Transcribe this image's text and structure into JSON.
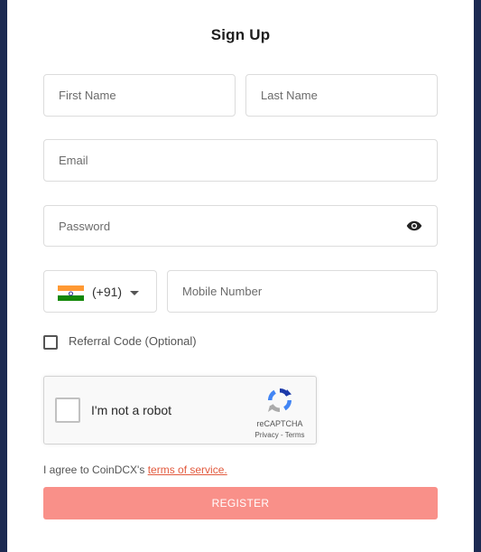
{
  "title": "Sign Up",
  "fields": {
    "first_name_placeholder": "First Name",
    "last_name_placeholder": "Last Name",
    "email_placeholder": "Email",
    "password_placeholder": "Password",
    "mobile_placeholder": "Mobile Number"
  },
  "country": {
    "code": "(+91)",
    "flag_icon": "india-flag-icon",
    "flag_colors": [
      "#ff9933",
      "#ffffff",
      "#138808"
    ]
  },
  "referral": {
    "label": "Referral Code (Optional)",
    "checked": false
  },
  "captcha": {
    "label": "I'm not a robot",
    "brand": "reCAPTCHA",
    "privacy": "Privacy",
    "separator": " - ",
    "terms": "Terms"
  },
  "agreement": {
    "text": "I agree to CoinDCX's ",
    "link": "terms of service."
  },
  "register_label": "REGISTER",
  "colors": {
    "background": "#1c2a52",
    "register_button": "#f99089",
    "link": "#e25a3e"
  }
}
